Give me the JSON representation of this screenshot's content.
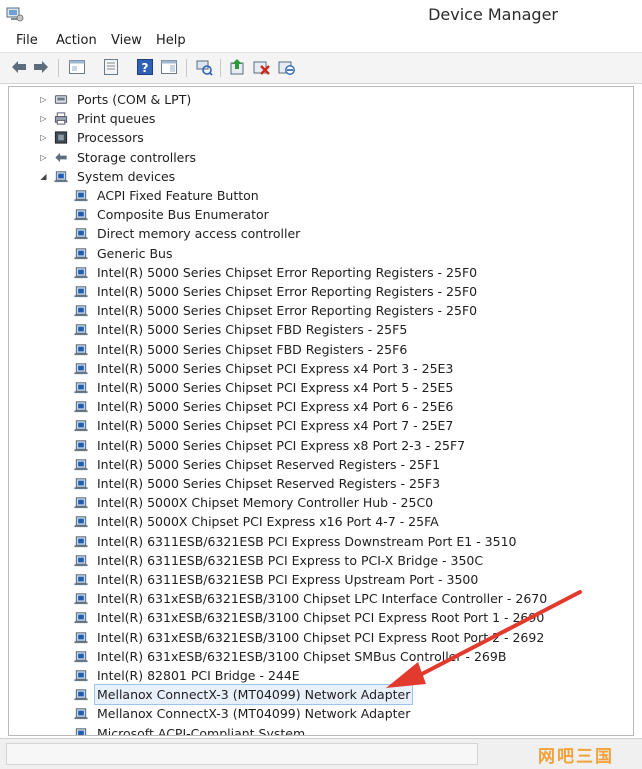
{
  "window": {
    "title": "Device Manager"
  },
  "menu": [
    "File",
    "Action",
    "View",
    "Help"
  ],
  "toolbar_icons": [
    "back-arrow-icon",
    "forward-arrow-icon",
    "show-hide-tree-icon",
    "properties-icon",
    "help-icon",
    "show-hide-action-pane-icon",
    "scan-hardware-changes-icon",
    "update-driver-icon",
    "uninstall-device-icon",
    "disable-device-icon"
  ],
  "tree": [
    {
      "label": "Ports (COM & LPT)",
      "level": 1,
      "expander": "collapsed",
      "icon": "ports-icon"
    },
    {
      "label": "Print queues",
      "level": 1,
      "expander": "collapsed",
      "icon": "printer-icon"
    },
    {
      "label": "Processors",
      "level": 1,
      "expander": "collapsed",
      "icon": "processor-icon"
    },
    {
      "label": "Storage controllers",
      "level": 1,
      "expander": "collapsed",
      "icon": "storage-controller-icon"
    },
    {
      "label": "System devices",
      "level": 1,
      "expander": "expanded",
      "icon": "system-devices-icon"
    },
    {
      "label": "ACPI Fixed Feature Button",
      "level": 2,
      "icon": "system-device-icon"
    },
    {
      "label": "Composite Bus Enumerator",
      "level": 2,
      "icon": "system-device-icon"
    },
    {
      "label": "Direct memory access controller",
      "level": 2,
      "icon": "system-device-icon"
    },
    {
      "label": "Generic Bus",
      "level": 2,
      "icon": "system-device-icon"
    },
    {
      "label": "Intel(R) 5000 Series Chipset Error Reporting Registers - 25F0",
      "level": 2,
      "icon": "system-device-icon"
    },
    {
      "label": "Intel(R) 5000 Series Chipset Error Reporting Registers - 25F0",
      "level": 2,
      "icon": "system-device-icon"
    },
    {
      "label": "Intel(R) 5000 Series Chipset Error Reporting Registers - 25F0",
      "level": 2,
      "icon": "system-device-icon"
    },
    {
      "label": "Intel(R) 5000 Series Chipset FBD Registers - 25F5",
      "level": 2,
      "icon": "system-device-icon"
    },
    {
      "label": "Intel(R) 5000 Series Chipset FBD Registers - 25F6",
      "level": 2,
      "icon": "system-device-icon"
    },
    {
      "label": "Intel(R) 5000 Series Chipset PCI Express x4 Port 3 - 25E3",
      "level": 2,
      "icon": "system-device-icon"
    },
    {
      "label": "Intel(R) 5000 Series Chipset PCI Express x4 Port 5 - 25E5",
      "level": 2,
      "icon": "system-device-icon"
    },
    {
      "label": "Intel(R) 5000 Series Chipset PCI Express x4 Port 6 - 25E6",
      "level": 2,
      "icon": "system-device-icon"
    },
    {
      "label": "Intel(R) 5000 Series Chipset PCI Express x4 Port 7 - 25E7",
      "level": 2,
      "icon": "system-device-icon"
    },
    {
      "label": "Intel(R) 5000 Series Chipset PCI Express x8 Port 2-3 - 25F7",
      "level": 2,
      "icon": "system-device-icon"
    },
    {
      "label": "Intel(R) 5000 Series Chipset Reserved Registers - 25F1",
      "level": 2,
      "icon": "system-device-icon"
    },
    {
      "label": "Intel(R) 5000 Series Chipset Reserved Registers - 25F3",
      "level": 2,
      "icon": "system-device-icon"
    },
    {
      "label": "Intel(R) 5000X Chipset Memory Controller Hub - 25C0",
      "level": 2,
      "icon": "system-device-icon"
    },
    {
      "label": "Intel(R) 5000X Chipset PCI Express x16 Port 4-7 - 25FA",
      "level": 2,
      "icon": "system-device-icon"
    },
    {
      "label": "Intel(R) 6311ESB/6321ESB PCI Express Downstream Port E1 - 3510",
      "level": 2,
      "icon": "system-device-icon"
    },
    {
      "label": "Intel(R) 6311ESB/6321ESB PCI Express to PCI-X Bridge - 350C",
      "level": 2,
      "icon": "system-device-icon"
    },
    {
      "label": "Intel(R) 6311ESB/6321ESB PCI Express Upstream Port - 3500",
      "level": 2,
      "icon": "system-device-icon"
    },
    {
      "label": "Intel(R) 631xESB/6321ESB/3100 Chipset LPC Interface Controller - 2670",
      "level": 2,
      "icon": "system-device-icon"
    },
    {
      "label": "Intel(R) 631xESB/6321ESB/3100 Chipset PCI Express Root Port 1 - 2690",
      "level": 2,
      "icon": "system-device-icon"
    },
    {
      "label": "Intel(R) 631xESB/6321ESB/3100 Chipset PCI Express Root Port 2 - 2692",
      "level": 2,
      "icon": "system-device-icon"
    },
    {
      "label": "Intel(R) 631xESB/6321ESB/3100 Chipset SMBus Controller - 269B",
      "level": 2,
      "icon": "system-device-icon"
    },
    {
      "label": "Intel(R) 82801 PCI Bridge - 244E",
      "level": 2,
      "icon": "system-device-icon"
    },
    {
      "label": "Mellanox ConnectX-3 (MT04099) Network Adapter",
      "level": 2,
      "icon": "system-device-icon",
      "selected": true
    },
    {
      "label": "Mellanox ConnectX-3 (MT04099) Network Adapter",
      "level": 2,
      "icon": "system-device-icon"
    },
    {
      "label": "Microsoft ACPI-Compliant System",
      "level": 2,
      "icon": "system-device-icon"
    }
  ],
  "watermark": "网吧三国",
  "colors": {
    "annotation_arrow": "#e23b2e",
    "selection_bg": "#e8f1fb",
    "selection_border": "#9cc4ee",
    "watermark": "#f1a23a"
  }
}
